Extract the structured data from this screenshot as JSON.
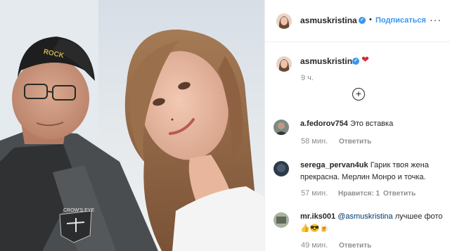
{
  "post": {
    "username": "asmuskristina",
    "follow_label": "Подписаться",
    "dot": "•",
    "more": "···",
    "caption_emoji": "❤",
    "caption_time": "9 ч.",
    "load_more": "+",
    "badge_photo": "CROW'S EYE",
    "cap_text": "ROCK"
  },
  "comments": [
    {
      "username": "a.fedorov754",
      "text": "Это вставка",
      "time": "58 мин.",
      "reply": "Ответить"
    },
    {
      "username": "serega_pervan4uk",
      "text": "Гарик твоя жена прекрасна. Мерлин Монро и точка.",
      "time": "57 мин.",
      "likes": "Нравится: 1",
      "reply": "Ответить"
    },
    {
      "username": "mr.iks001",
      "mention": "@asmuskristina",
      "text": "лучшее фото 👍😎🍺",
      "time": "49 мин.",
      "reply": "Ответить"
    }
  ],
  "colors": {
    "link": "#3897f0",
    "muted": "#8e8e8e",
    "border": "#efefef"
  }
}
